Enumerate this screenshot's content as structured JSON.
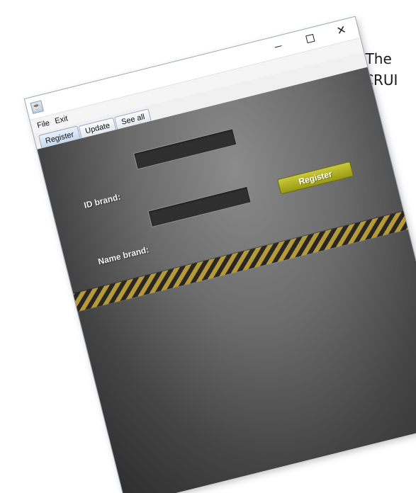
{
  "document": {
    "line1": "o The",
    "line2": "CRUI"
  },
  "window": {
    "icon": "java-cup-icon",
    "controls": {
      "minimize_icon": "minimize-icon",
      "maximize_icon": "maximize-icon",
      "close_symbol": "✕"
    }
  },
  "menubar": {
    "items": [
      {
        "label": "File"
      },
      {
        "label": "Exit"
      }
    ]
  },
  "tabs": [
    {
      "label": "Register",
      "active": true
    },
    {
      "label": "Update",
      "active": false
    },
    {
      "label": "See all",
      "active": false
    }
  ],
  "form": {
    "id_label": "ID brand:",
    "id_value": "",
    "name_label": "Name brand:",
    "name_value": "",
    "register_button": "Register"
  },
  "colors": {
    "button_accent": "#b5b51f",
    "hazard_yellow": "#b59a3a",
    "panel_dark": "#3a3a3a"
  }
}
